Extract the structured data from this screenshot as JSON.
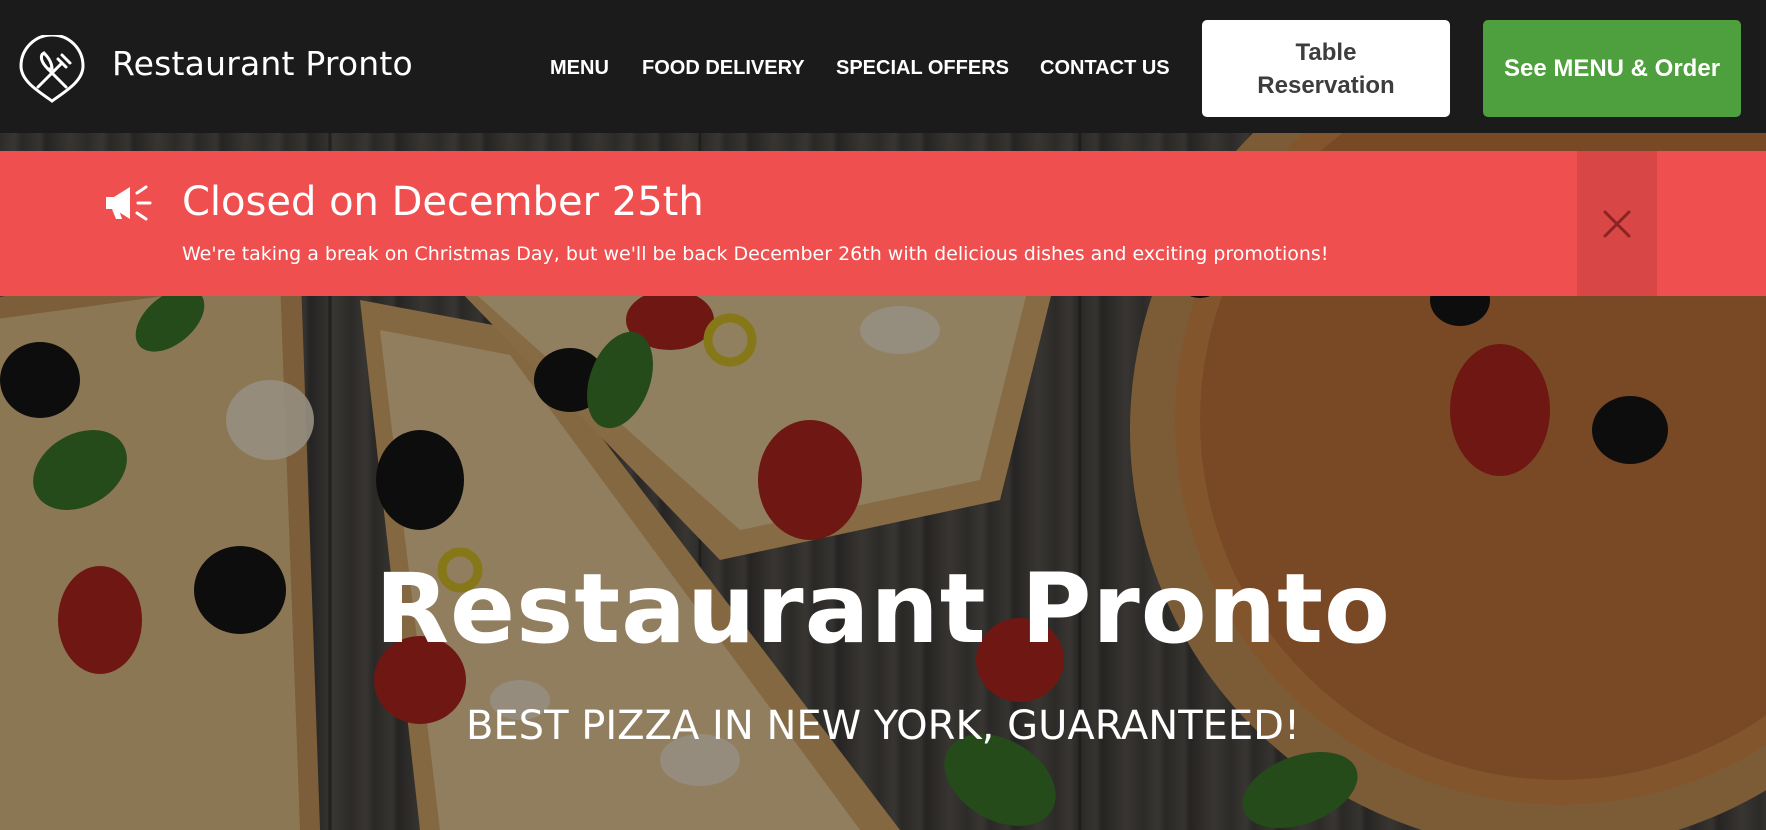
{
  "header": {
    "brand": "Restaurant Pronto",
    "logo_icon": "fork-knife-icon",
    "nav": [
      {
        "label": "MENU"
      },
      {
        "label": "FOOD DELIVERY"
      },
      {
        "label": "SPECIAL OFFERS"
      },
      {
        "label": "CONTACT US"
      }
    ],
    "reserve_button": "Table Reservation",
    "order_button": "See MENU & Order"
  },
  "notice": {
    "icon": "megaphone-icon",
    "title": "Closed on December 25th",
    "text": "We're taking a break on Christmas Day, but we'll be back December 26th with delicious dishes and exciting promotions!",
    "close_icon": "close-icon"
  },
  "hero": {
    "title": "Restaurant Pronto",
    "subtitle": "BEST PIZZA IN NEW YORK, GUARANTEED!"
  },
  "colors": {
    "header_bg": "#1b1b1b",
    "notice_bg": "#ef4f4f",
    "notice_close_bg": "#d84646",
    "order_button_bg": "#4e9f3d",
    "reserve_button_bg": "#ffffff"
  }
}
